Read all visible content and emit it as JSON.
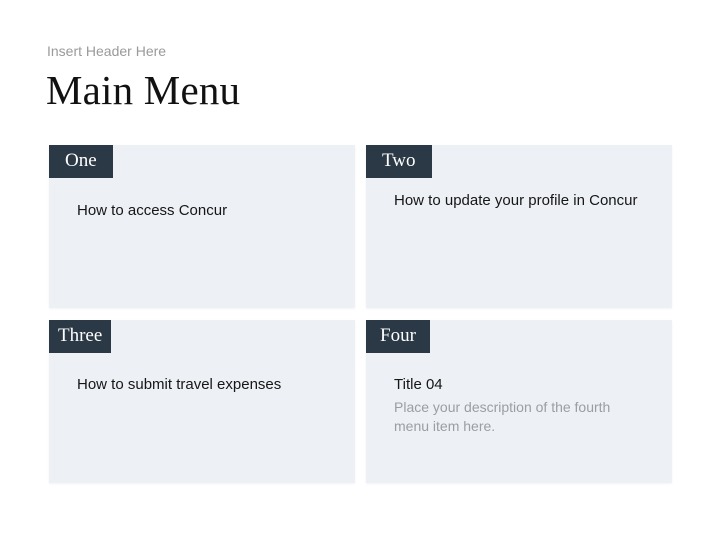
{
  "slide": {
    "subheader": "Insert Header Here",
    "title": "Main Menu"
  },
  "cards": [
    {
      "tag": "One",
      "title": "How to access Concur"
    },
    {
      "tag": "Two",
      "title": "How to update your profile in Concur"
    },
    {
      "tag": "Three",
      "title": "How to submit travel expenses"
    },
    {
      "tag": "Four",
      "title": "Title 04",
      "description": "Place your description of the fourth menu item here."
    }
  ],
  "colors": {
    "background": "#ffffff",
    "card_background": "#edf0f5",
    "tag_background": "#2b3845",
    "tag_text": "#ffffff",
    "title_text": "#111111",
    "muted_text": "#9a9a9a"
  }
}
